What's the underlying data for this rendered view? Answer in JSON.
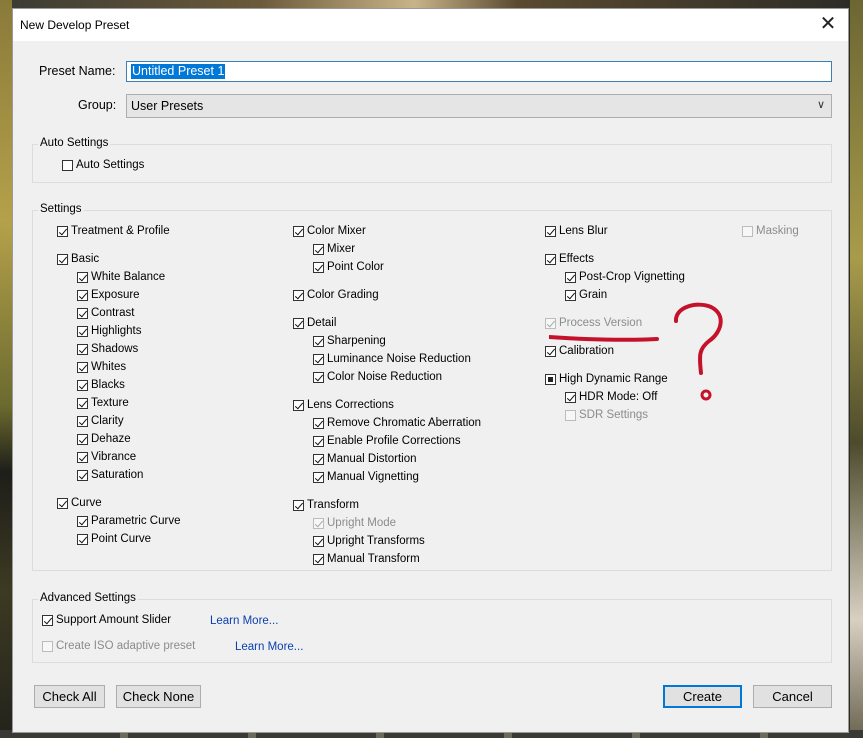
{
  "dialog": {
    "title": "New Develop Preset"
  },
  "preset_name": {
    "label": "Preset Name:",
    "value": "Untitled Preset 1"
  },
  "group": {
    "label": "Group:",
    "value": "User Presets"
  },
  "auto_settings": {
    "title": "Auto Settings",
    "checkbox": "Auto Settings"
  },
  "settings": {
    "title": "Settings",
    "col1": {
      "treatment": "Treatment & Profile",
      "basic": "Basic",
      "white_balance": "White Balance",
      "exposure": "Exposure",
      "contrast": "Contrast",
      "highlights": "Highlights",
      "shadows": "Shadows",
      "whites": "Whites",
      "blacks": "Blacks",
      "texture": "Texture",
      "clarity": "Clarity",
      "dehaze": "Dehaze",
      "vibrance": "Vibrance",
      "saturation": "Saturation",
      "curve": "Curve",
      "parametric_curve": "Parametric Curve",
      "point_curve": "Point Curve"
    },
    "col2": {
      "color_mixer": "Color Mixer",
      "mixer": "Mixer",
      "point_color": "Point Color",
      "color_grading": "Color Grading",
      "detail": "Detail",
      "sharpening": "Sharpening",
      "luminance_nr": "Luminance Noise Reduction",
      "color_nr": "Color Noise Reduction",
      "lens_corrections": "Lens Corrections",
      "remove_ca": "Remove Chromatic Aberration",
      "profile_corrections": "Enable Profile Corrections",
      "manual_distortion": "Manual Distortion",
      "manual_vignetting": "Manual Vignetting",
      "transform": "Transform",
      "upright_mode": "Upright Mode",
      "upright_transforms": "Upright Transforms",
      "manual_transform": "Manual Transform"
    },
    "col3": {
      "lens_blur": "Lens Blur",
      "masking": "Masking",
      "effects": "Effects",
      "post_crop_vignetting": "Post-Crop Vignetting",
      "grain": "Grain",
      "process_version": "Process Version",
      "calibration": "Calibration",
      "hdr": "High Dynamic Range",
      "hdr_mode": "HDR Mode: Off",
      "sdr_settings": "SDR Settings"
    }
  },
  "advanced": {
    "title": "Advanced Settings",
    "support_amount": "Support Amount Slider",
    "create_iso": "Create ISO adaptive preset",
    "learn_more_1": "Learn More...",
    "learn_more_2": "Learn More..."
  },
  "buttons": {
    "check_all": "Check All",
    "check_none": "Check None",
    "create": "Create",
    "cancel": "Cancel"
  },
  "colors": {
    "accent": "#0078d7",
    "annotation": "#c4122a"
  }
}
